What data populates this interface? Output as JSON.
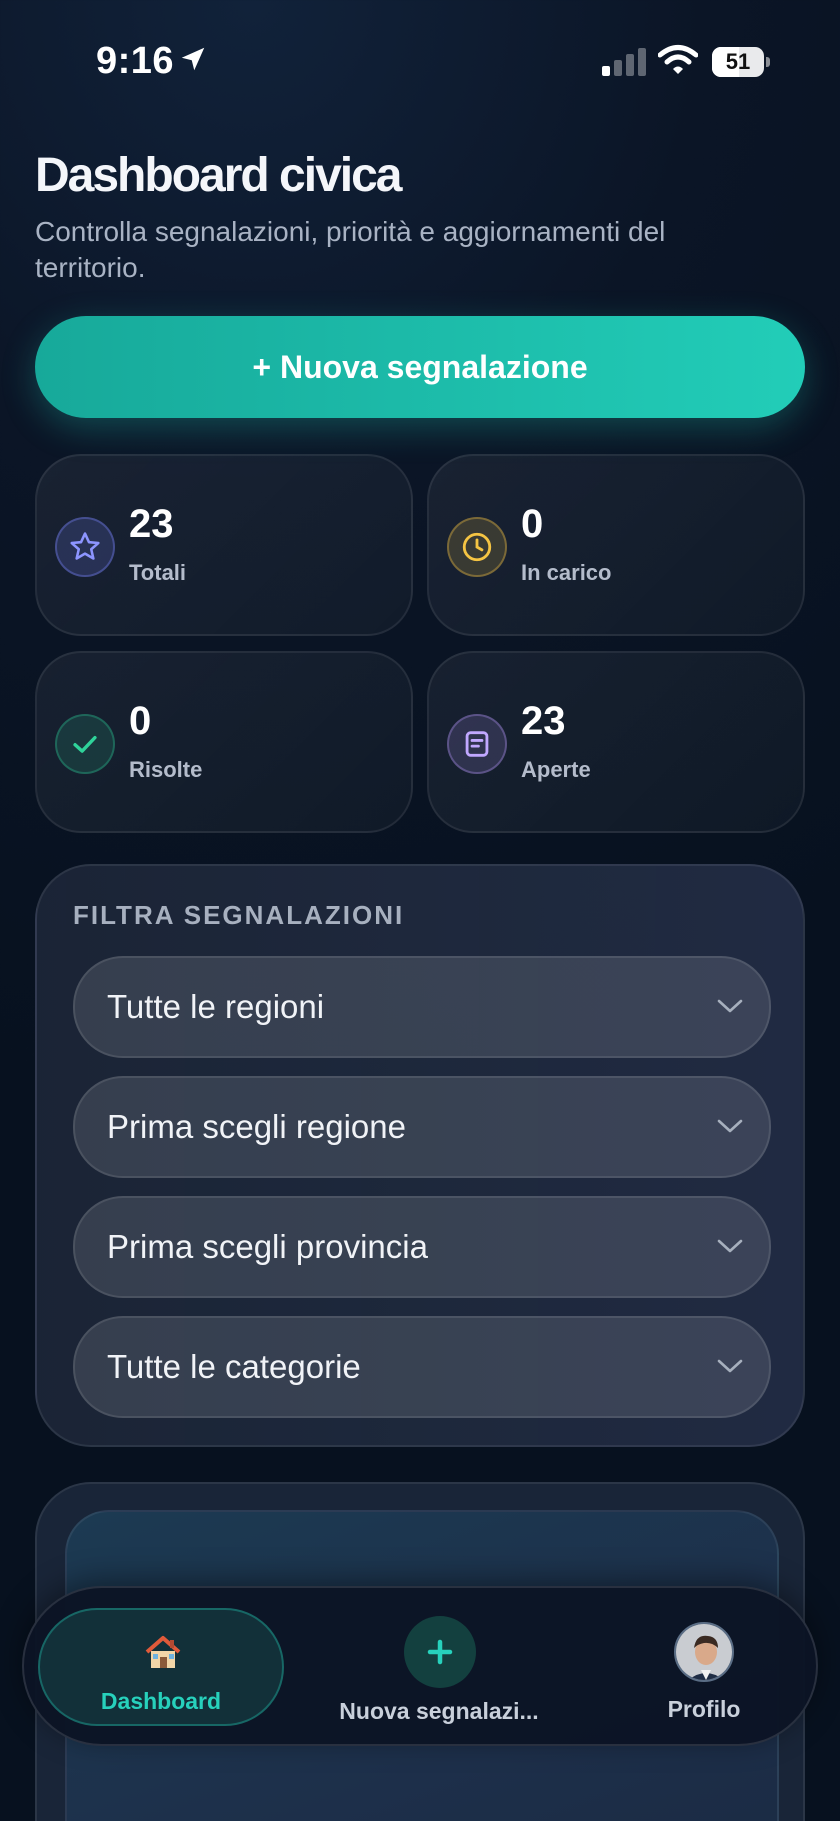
{
  "status_bar": {
    "time": "9:16",
    "battery_level": "51"
  },
  "header": {
    "title": "Dashboard civica",
    "subtitle": "Controlla segnalazioni, priorità e aggiornamenti del territorio."
  },
  "actions": {
    "new_report_label": "+ Nuova segnalazione"
  },
  "stats": [
    {
      "value": "23",
      "label": "Totali",
      "icon": "star-icon",
      "color": "#7c86ff"
    },
    {
      "value": "0",
      "label": "In carico",
      "icon": "clock-icon",
      "color": "#f5c443"
    },
    {
      "value": "0",
      "label": "Risolte",
      "icon": "check-icon",
      "color": "#2fd39a"
    },
    {
      "value": "23",
      "label": "Aperte",
      "icon": "document-icon",
      "color": "#b89cff"
    }
  ],
  "filters": {
    "title": "FILTRA SEGNALAZIONI",
    "region": "Tutte le regioni",
    "province": "Prima scegli regione",
    "municipality": "Prima scegli provincia",
    "category": "Tutte le categorie"
  },
  "tab_bar": {
    "dashboard_label": "Dashboard",
    "new_report_label": "Nuova segnalazi...",
    "profile_label": "Profilo",
    "active_tab": "Dashboard",
    "accent_color": "#27d1bc"
  }
}
